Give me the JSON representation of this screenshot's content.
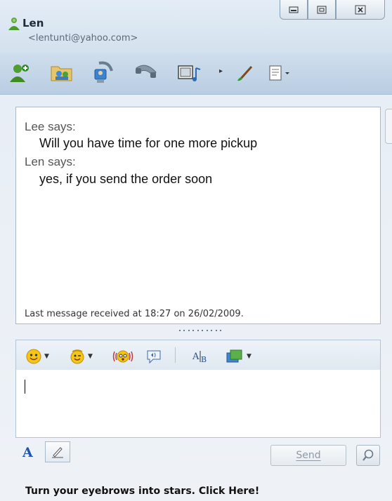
{
  "contact": {
    "name": "Len",
    "email": "<lentunti@yahoo.com>"
  },
  "conversation": {
    "messages": [
      {
        "sender": "Lee says:",
        "text": "Will you have time for one more pickup"
      },
      {
        "sender": "Len says:",
        "text": "yes, if you send the order soon"
      }
    ],
    "status": "Last message received at 18:27 on 26/02/2009."
  },
  "compose": {
    "font_label": "A",
    "send_label": "Send",
    "send_access_key": "S"
  },
  "ad": {
    "text": "Turn your eyebrows into stars. Click Here!"
  },
  "colors": {
    "titlebar": "#d3e1ee",
    "toolbar": "#b9cde2",
    "window_bg": "#e8eef6"
  },
  "icons": {
    "toolbar": [
      "invite-contact-icon",
      "share-folder-icon",
      "webcam-icon",
      "voice-call-icon",
      "video-clip-icon",
      "more-arrow-icon",
      "theme-brush-icon",
      "menu-icon"
    ],
    "compose_toolbar": [
      "emoticon-icon",
      "wink-icon",
      "nudge-icon",
      "voice-clip-icon",
      "font-icon",
      "background-icon"
    ]
  }
}
